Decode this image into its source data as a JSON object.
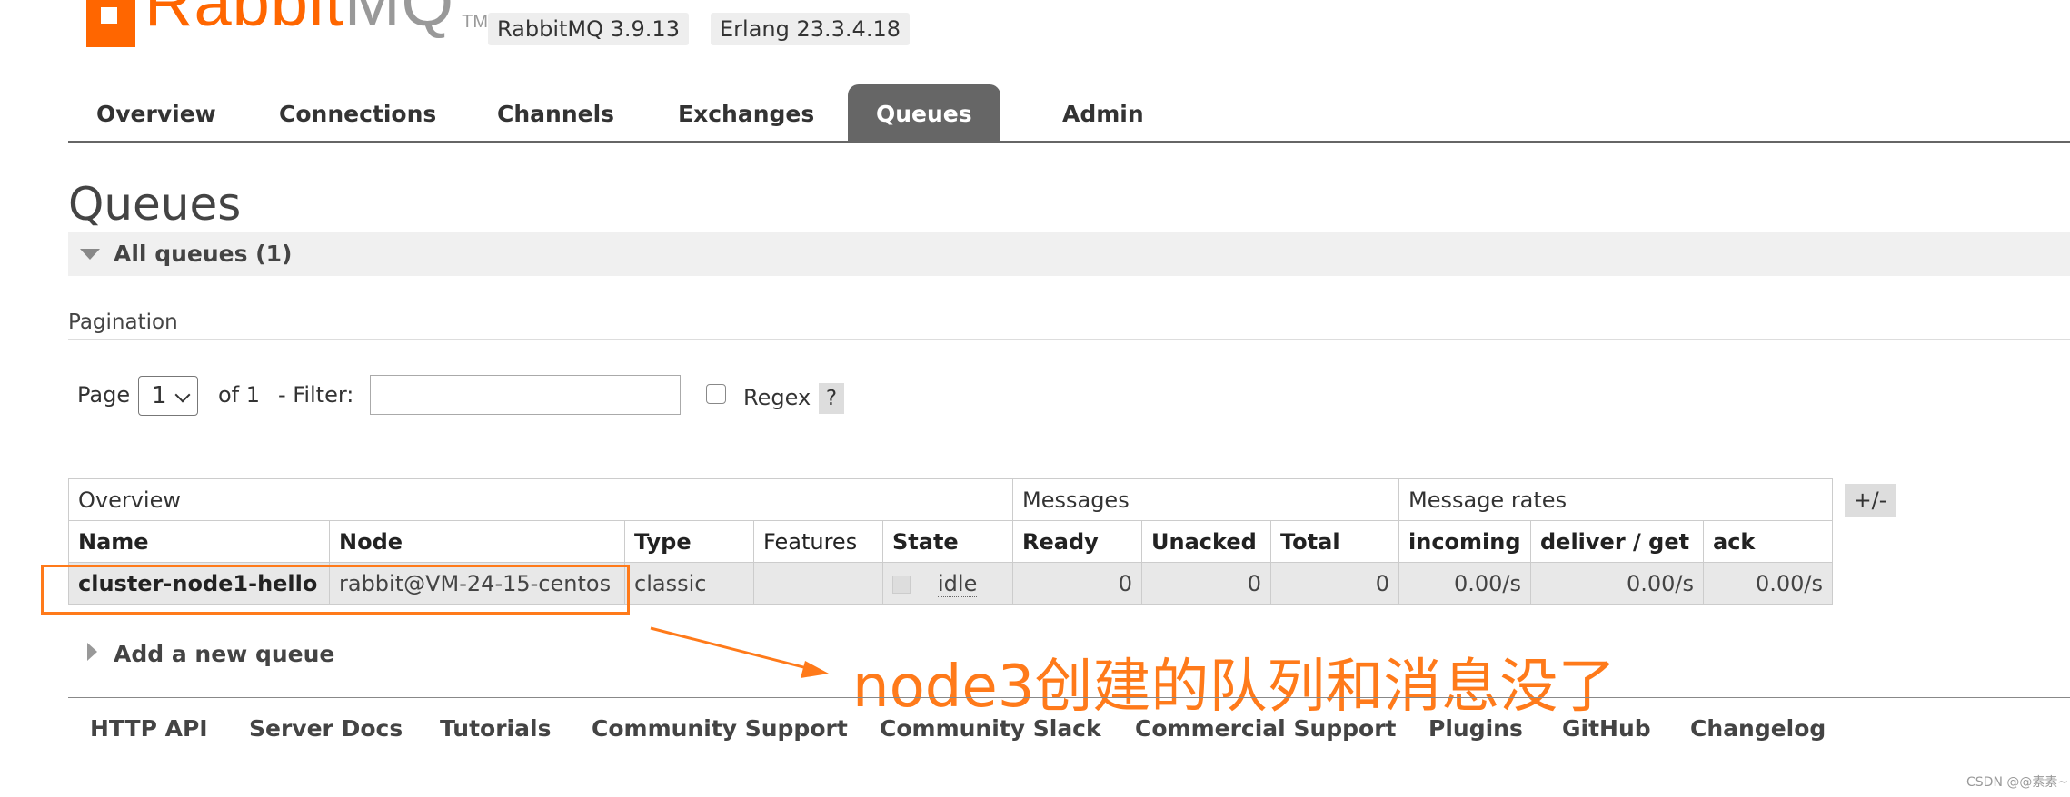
{
  "brand": {
    "name_part1": "Rabbit",
    "name_part2": "MQ",
    "tm": "TM"
  },
  "versions": [
    "RabbitMQ 3.9.13",
    "Erlang 23.3.4.18"
  ],
  "nav": {
    "tabs": [
      "Overview",
      "Connections",
      "Channels",
      "Exchanges",
      "Queues",
      "Admin"
    ],
    "active": "Queues"
  },
  "page": {
    "title": "Queues",
    "section": "All queues (1)"
  },
  "pagination": {
    "label": "Pagination",
    "page_label": "Page",
    "page_value": "1",
    "of_label": "of 1",
    "filter_label": "- Filter:",
    "filter_value": "",
    "regex_label": "Regex",
    "regex_checked": false,
    "help": "?"
  },
  "table": {
    "groups": [
      "Overview",
      "Messages",
      "Message rates"
    ],
    "columns": [
      "Name",
      "Node",
      "Type",
      "Features",
      "State",
      "Ready",
      "Unacked",
      "Total",
      "incoming",
      "deliver / get",
      "ack"
    ],
    "rows": [
      {
        "name": "cluster-node1-hello",
        "node": "rabbit@VM-24-15-centos",
        "type": "classic",
        "features": "",
        "state": "idle",
        "ready": "0",
        "unacked": "0",
        "total": "0",
        "incoming": "0.00/s",
        "deliver_get": "0.00/s",
        "ack": "0.00/s"
      }
    ],
    "toggle": "+/-"
  },
  "add_queue": "Add a new queue",
  "annotation": {
    "text": "node3创建的队列和消息没了",
    "color": "#ff7a1a"
  },
  "footer": [
    "HTTP API",
    "Server Docs",
    "Tutorials",
    "Community Support",
    "Community Slack",
    "Commercial Support",
    "Plugins",
    "GitHub",
    "Changelog"
  ],
  "watermark": "CSDN @@素素~",
  "colors": {
    "brand": "#ff6600",
    "tab_active_bg": "#666666",
    "highlight": "#ff7a1a"
  }
}
